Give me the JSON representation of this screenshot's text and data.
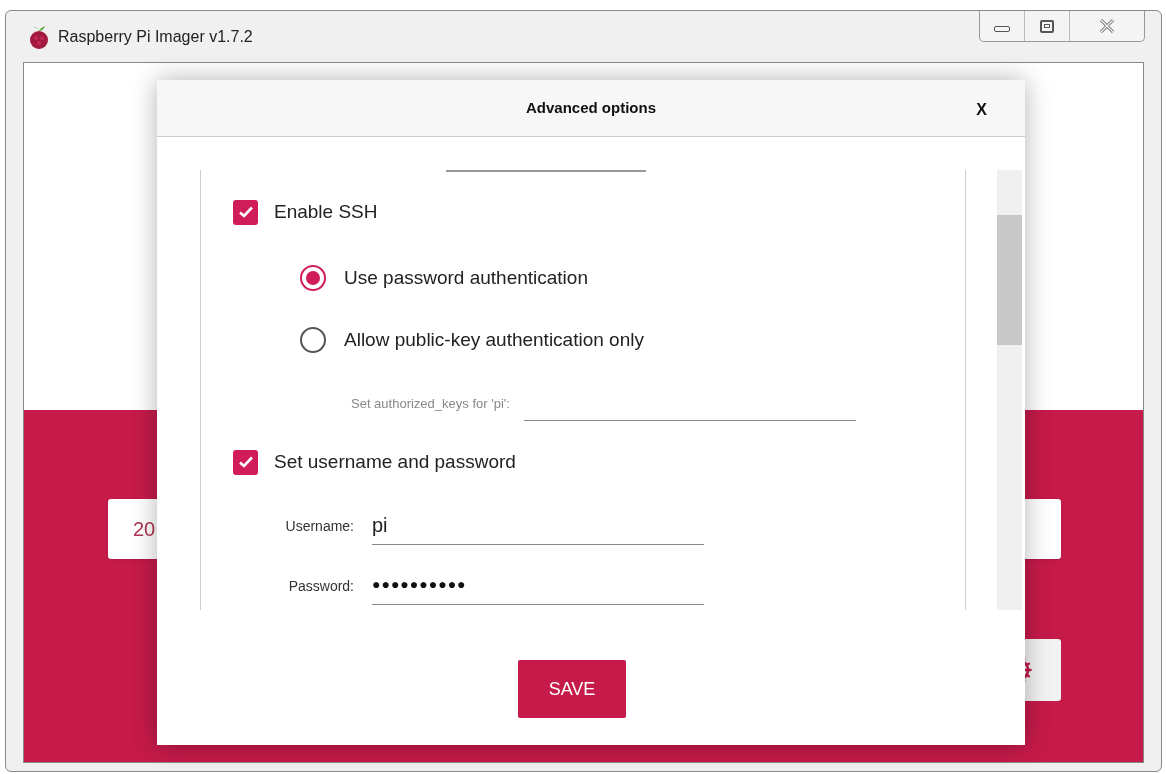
{
  "window": {
    "title": "Raspberry Pi Imager v1.7.2"
  },
  "background": {
    "select_button": {
      "text": "20"
    }
  },
  "dialog": {
    "title": "Advanced options",
    "close": "X",
    "ssh": {
      "label": "Enable SSH",
      "checked": true
    },
    "auth_options": [
      {
        "label": "Use password authentication",
        "selected": true
      },
      {
        "label": "Allow public-key authentication only",
        "selected": false
      }
    ],
    "authorized_keys": {
      "label": "Set authorized_keys for 'pi':"
    },
    "credentials": {
      "label": "Set username and password",
      "checked": true
    },
    "username": {
      "label": "Username:",
      "value": "pi"
    },
    "password": {
      "label": "Password:",
      "value": "●●●●●●●●●●"
    },
    "save": "SAVE"
  }
}
